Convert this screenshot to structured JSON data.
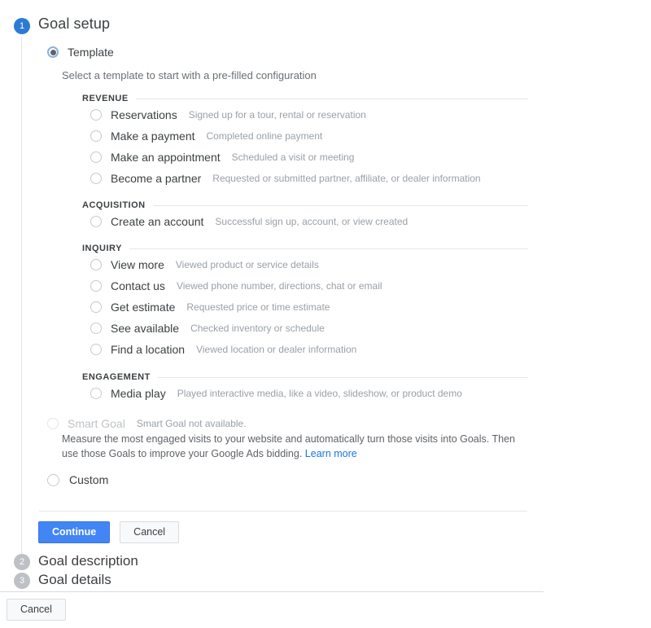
{
  "steps": [
    {
      "number": "1",
      "title": "Goal setup",
      "state": "active"
    },
    {
      "number": "2",
      "title": "Goal description",
      "state": "inactive"
    },
    {
      "number": "3",
      "title": "Goal details",
      "state": "inactive"
    }
  ],
  "goal_type": {
    "template": {
      "label": "Template",
      "hint": "Select a template to start with a pre-filled configuration",
      "selected": true
    },
    "smart_goal": {
      "label": "Smart Goal",
      "note": "Smart Goal not available.",
      "description": "Measure the most engaged visits to your website and automatically turn those visits into Goals. Then use those Goals to improve your Google Ads bidding.",
      "link_label": "Learn more",
      "disabled": true
    },
    "custom": {
      "label": "Custom",
      "selected": false
    }
  },
  "template_groups": [
    {
      "heading": "REVENUE",
      "options": [
        {
          "label": "Reservations",
          "description": "Signed up for a tour, rental or reservation"
        },
        {
          "label": "Make a payment",
          "description": "Completed online payment"
        },
        {
          "label": "Make an appointment",
          "description": "Scheduled a visit or meeting"
        },
        {
          "label": "Become a partner",
          "description": "Requested or submitted partner, affiliate, or dealer information"
        }
      ]
    },
    {
      "heading": "ACQUISITION",
      "options": [
        {
          "label": "Create an account",
          "description": "Successful sign up, account, or view created"
        }
      ]
    },
    {
      "heading": "INQUIRY",
      "options": [
        {
          "label": "View more",
          "description": "Viewed product or service details"
        },
        {
          "label": "Contact us",
          "description": "Viewed phone number, directions, chat or email"
        },
        {
          "label": "Get estimate",
          "description": "Requested price or time estimate"
        },
        {
          "label": "See available",
          "description": "Checked inventory or schedule"
        },
        {
          "label": "Find a location",
          "description": "Viewed location or dealer information"
        }
      ]
    },
    {
      "heading": "ENGAGEMENT",
      "options": [
        {
          "label": "Media play",
          "description": "Played interactive media, like a video, slideshow, or product demo"
        }
      ]
    }
  ],
  "actions": {
    "continue_label": "Continue",
    "cancel_label": "Cancel",
    "footer_cancel_label": "Cancel"
  },
  "colors": {
    "accent_blue": "#4285f4",
    "step_active": "#2d7ad3",
    "step_inactive": "#bdc1c6",
    "link_blue": "#1a73e8",
    "label_text": "#3c4043",
    "description_text": "#9aa0a6"
  }
}
